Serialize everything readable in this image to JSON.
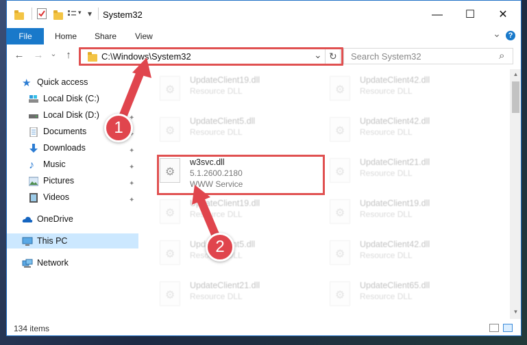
{
  "window": {
    "title": "System32",
    "minimize_glyph": "—",
    "maximize_glyph": "☐",
    "close_glyph": "✕"
  },
  "ribbon": {
    "tabs": [
      "File",
      "Home",
      "Share",
      "View"
    ],
    "expand_glyph": "⌄",
    "help_glyph": "?"
  },
  "nav": {
    "back_glyph": "←",
    "forward_glyph": "→",
    "dropdown_glyph": "⌄",
    "up_glyph": "↑",
    "refresh_glyph": "↻"
  },
  "address": {
    "path": "C:\\Windows\\System32",
    "dropdown_glyph": "⌄"
  },
  "search": {
    "placeholder": "Search System32",
    "icon_glyph": "⌕"
  },
  "sidebar": {
    "pin_glyph": "✦",
    "items": [
      {
        "label": "Quick access",
        "icon": "star-icon"
      },
      {
        "label": "Local Disk (C:)",
        "icon": "drive-icon"
      },
      {
        "label": "Local Disk (D:)",
        "icon": "drive-icon"
      },
      {
        "label": "Documents",
        "icon": "documents-icon"
      },
      {
        "label": "Downloads",
        "icon": "downloads-icon"
      },
      {
        "label": "Music",
        "icon": "music-icon"
      },
      {
        "label": "Pictures",
        "icon": "pictures-icon"
      },
      {
        "label": "Videos",
        "icon": "videos-icon"
      },
      {
        "label": "OneDrive",
        "icon": "cloud-icon"
      },
      {
        "label": "This PC",
        "icon": "computer-icon"
      },
      {
        "label": "Network",
        "icon": "network-icon"
      }
    ]
  },
  "files": {
    "left": [
      {
        "name": "UpdateClient19.dll",
        "desc": "Resource DLL"
      },
      {
        "name": "UpdateClient5.dll",
        "desc": "Resource DLL"
      },
      {
        "name": "w3svc.dll",
        "version": "5.1.2600.2180",
        "desc": "WWW Service"
      },
      {
        "name": "UpdateClient19.dll",
        "desc": "Resource DLL"
      },
      {
        "name": "UpdateClient5.dll",
        "desc": "Resource DLL"
      },
      {
        "name": "UpdateClient21.dll",
        "desc": "Resource DLL"
      }
    ],
    "right": [
      {
        "name": "UpdateClient42.dll",
        "desc": "Resource DLL"
      },
      {
        "name": "UpdateClient42.dll",
        "desc": "Resource DLL"
      },
      {
        "name": "UpdateClient21.dll",
        "desc": "Resource DLL"
      },
      {
        "name": "UpdateClient19.dll",
        "desc": "Resource DLL"
      },
      {
        "name": "UpdateClient42.dll",
        "desc": "Resource DLL"
      },
      {
        "name": "UpdateClient65.dll",
        "desc": "Resource DLL"
      }
    ]
  },
  "scrollbar": {
    "up_glyph": "▲",
    "down_glyph": "▼"
  },
  "status": {
    "item_count": "134 items"
  },
  "annotations": {
    "step1": "1",
    "step2": "2",
    "color": "#e0454d"
  }
}
